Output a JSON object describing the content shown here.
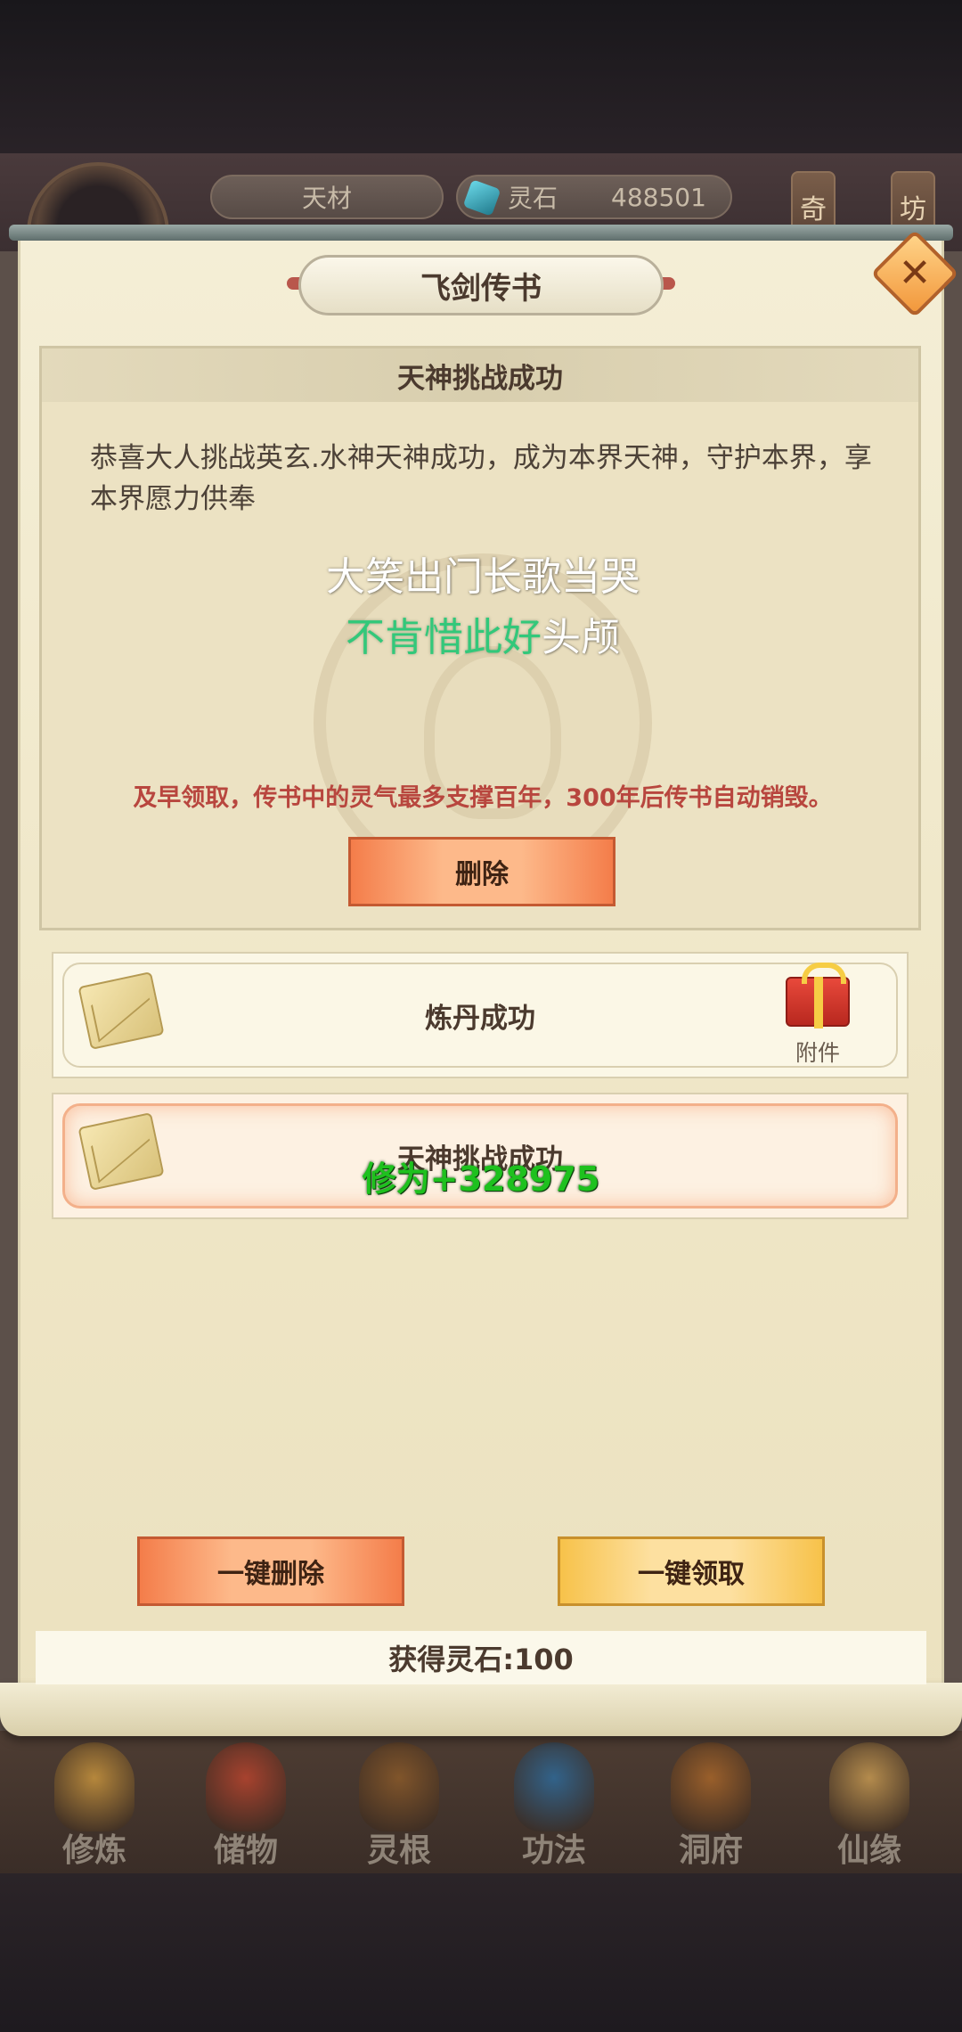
{
  "hud": {
    "talent_label": "天材",
    "stone_label": "灵石",
    "stone_value": "488501",
    "tag_left": "奇",
    "tag_right": "坊"
  },
  "dialog": {
    "title": "飞剑传书",
    "close_icon": "close-icon"
  },
  "mail_detail": {
    "subject": "天神挑战成功",
    "body": "恭喜大人挑战英玄.水神天神成功，成为本界天神，守护本界，享本界愿力供奉",
    "poem_line1": "大笑出门长歌当哭",
    "poem_line2_highlight": "不肯惜此好",
    "poem_line2_rest": "头颅",
    "warning": "及早领取，传书中的灵气最多支撑百年，300年后传书自动销毁。",
    "delete_label": "删除"
  },
  "mail_list": [
    {
      "title": "炼丹成功",
      "has_attachment": true,
      "attachment_label": "附件",
      "selected": false
    },
    {
      "title": "天神挑战成功",
      "has_attachment": false,
      "selected": true
    }
  ],
  "floating_text": "修为+328975",
  "actions": {
    "bulk_delete_label": "一键删除",
    "bulk_claim_label": "一键领取"
  },
  "status": "获得灵石:100",
  "bottom_nav": [
    {
      "label": "修炼",
      "color": "#c9953e"
    },
    {
      "label": "储物",
      "color": "#b8442e"
    },
    {
      "label": "灵根",
      "color": "#8a5a2a"
    },
    {
      "label": "功法",
      "color": "#2e6a9a"
    },
    {
      "label": "洞府",
      "color": "#a8662a"
    },
    {
      "label": "仙缘",
      "color": "#c79a52"
    }
  ],
  "colors": {
    "accent_orange": "#f47d4a",
    "accent_yellow": "#f7c24a",
    "warning_red": "#b8463e",
    "gain_green": "#1ec11e"
  }
}
